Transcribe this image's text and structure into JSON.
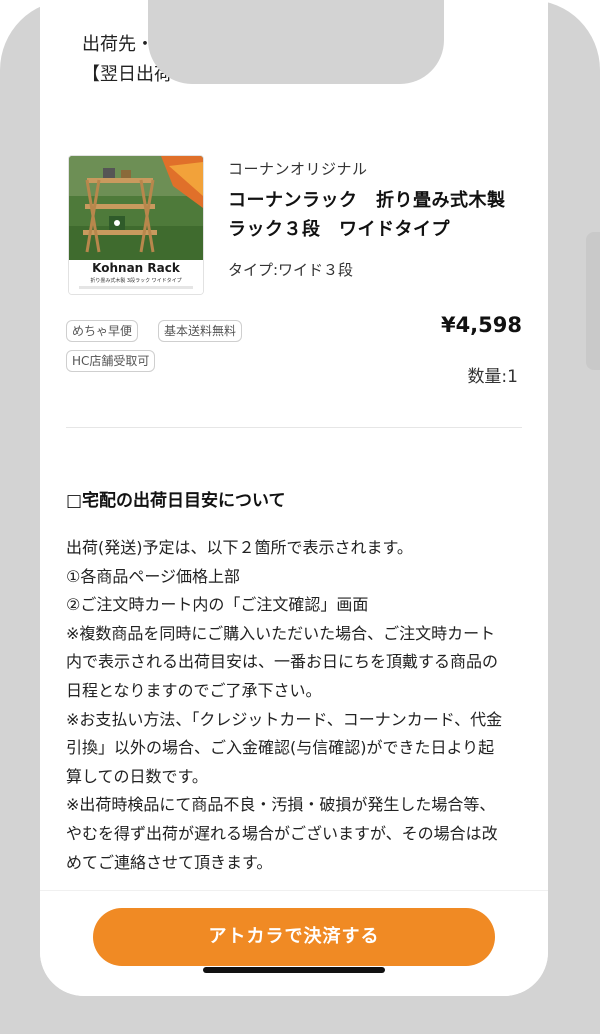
{
  "shipping": {
    "destination_label": "出荷先・",
    "next_day_label": "【翌日出荷"
  },
  "product": {
    "brand": "コーナンオリジナル",
    "name_line1": "コーナンラック　折り畳み式木製",
    "name_line2": "ラック３段　ワイドタイプ",
    "variant": "タイプ:ワイド３段",
    "image_text": {
      "title": "Kohnan Rack",
      "subtitle": "折り畳み式木製 3段ラック ワイドタイプ"
    },
    "tags": [
      "めちゃ早便",
      "基本送料無料",
      "HC店舗受取可"
    ],
    "price": "¥4,598",
    "quantity_label": "数量:",
    "quantity": "1"
  },
  "info": {
    "title": "□宅配の出荷日目安について",
    "paragraphs": [
      "出荷(発送)予定は、以下２箇所で表示されます。",
      "①各商品ページ価格上部",
      "②ご注文時カート内の「ご注文確認」画面",
      "※複数商品を同時にご購入いただいた場合、ご注文時カート内で表示される出荷目安は、一番お日にちを頂戴する商品の日程となりますのでご了承下さい。",
      "※お支払い方法、「クレジットカード、コーナンカード、代金引換」以外の場合、ご入金確認(与信確認)ができた日より起算しての日数です。",
      "※出荷時検品にて商品不良・汚損・破損が発生した場合等、やむを得ず出荷が遅れる場合がございますが、その場合は改めてご連絡させて頂きます。"
    ]
  },
  "checkout": {
    "button_label": "アトカラで決済する"
  },
  "colors": {
    "accent": "#f08a24",
    "frame": "#d3d3d3"
  }
}
